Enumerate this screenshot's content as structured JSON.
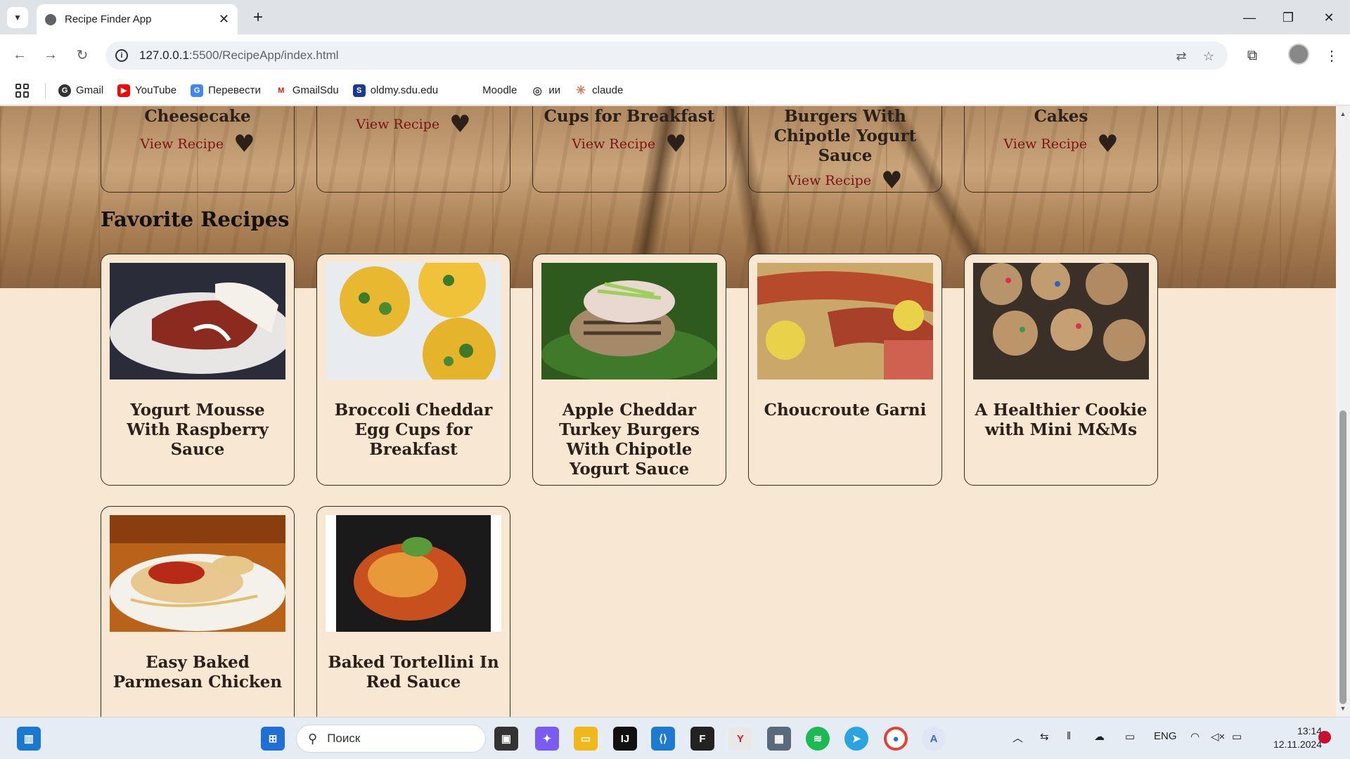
{
  "browser": {
    "tab_title": "Recipe Finder App",
    "url_host": "127.0.0.1",
    "url_path": ":5500/RecipeApp/index.html",
    "bookmarks": [
      {
        "label": "Gmail",
        "color": "#333333",
        "glyph": "G"
      },
      {
        "label": "YouTube",
        "color": "#ff0000",
        "glyph": "▶"
      },
      {
        "label": "Перевести",
        "color": "#4285f4",
        "glyph": "G"
      },
      {
        "label": "GmailSdu",
        "color": "#c5221f",
        "glyph": "M"
      },
      {
        "label": "oldmy.sdu.edu",
        "color": "#1a3a8f",
        "glyph": "S"
      },
      {
        "label": "Moodle",
        "color": "#ffffff",
        "glyph": ""
      },
      {
        "label": "ии",
        "color": "#555555",
        "glyph": "◎"
      },
      {
        "label": "claude",
        "color": "#d97757",
        "glyph": "✳"
      }
    ]
  },
  "page": {
    "top_cards": [
      {
        "name": "Cheesecake",
        "view_label": "View Recipe"
      },
      {
        "name": "",
        "view_label": "View Recipe"
      },
      {
        "name": "Cups for Breakfast",
        "view_label": "View Recipe"
      },
      {
        "name": "Burgers With Chipotle Yogurt Sauce",
        "view_label": "View Recipe"
      },
      {
        "name": "Cakes",
        "view_label": "View Recipe"
      }
    ],
    "section_title": "Favorite Recipes",
    "favorites": [
      {
        "name": "Yogurt Mousse With Raspberry Sauce",
        "image": "dessert-plate"
      },
      {
        "name": "Broccoli Cheddar Egg Cups for Breakfast",
        "image": "egg-cups"
      },
      {
        "name": "Apple Cheddar Turkey Burgers With Chipotle Yogurt Sauce",
        "image": "turkey-burger"
      },
      {
        "name": "Choucroute Garni",
        "image": "sausages-potatoes"
      },
      {
        "name": "A Healthier Cookie with Mini M&Ms",
        "image": "cookies"
      },
      {
        "name": "Easy Baked Parmesan Chicken",
        "image": "chicken-spaghetti"
      },
      {
        "name": "Baked Tortellini In Red Sauce",
        "image": "tortellini"
      }
    ],
    "heart_glyph": "♥"
  },
  "taskbar": {
    "search_placeholder": "Поиск",
    "language": "ENG",
    "time": "13:14",
    "date": "12.11.2024"
  }
}
